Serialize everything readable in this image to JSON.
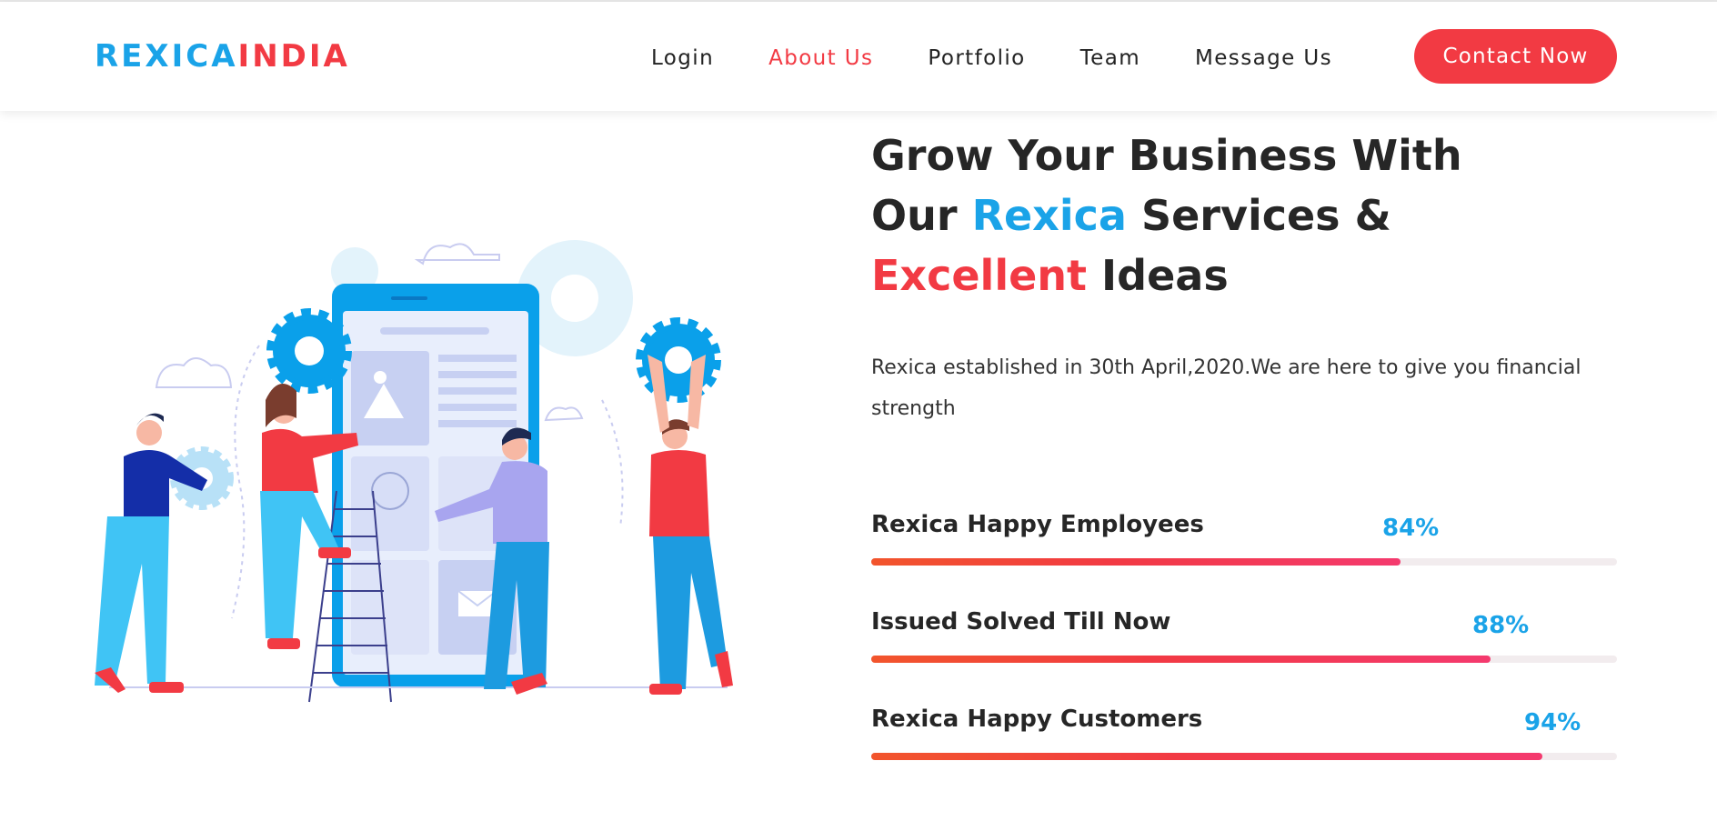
{
  "brand": {
    "part1": "REXICA",
    "part2": "INDIA",
    "color1": "#1aa3e8",
    "color2": "#f23a43"
  },
  "nav": {
    "items": [
      {
        "label": "Login",
        "active": false
      },
      {
        "label": "About Us",
        "active": true
      },
      {
        "label": "Portfolio",
        "active": false
      },
      {
        "label": "Team",
        "active": false
      },
      {
        "label": "Message Us",
        "active": false
      }
    ],
    "cta_label": "Contact Now"
  },
  "hero": {
    "line1": "Grow Your Business With",
    "line2_prefix": "Our ",
    "line2_highlight": "Rexica",
    "line2_suffix": " Services &",
    "line3_highlight": "Excellent",
    "line3_suffix": " Ideas",
    "description": "Rexica established in 30th April,2020.We are here to give you financial strength",
    "illustration": "team-building-app-illustration"
  },
  "stats": [
    {
      "label": "Rexica Happy Employees",
      "percent_label": "84%",
      "value": 0.71
    },
    {
      "label": "Issued Solved Till Now",
      "percent_label": "88%",
      "value": 0.83
    },
    {
      "label": "Rexica Happy Customers",
      "percent_label": "94%",
      "value": 0.9
    }
  ],
  "colors": {
    "accent_blue": "#1aa3e8",
    "accent_red": "#f23a43"
  }
}
